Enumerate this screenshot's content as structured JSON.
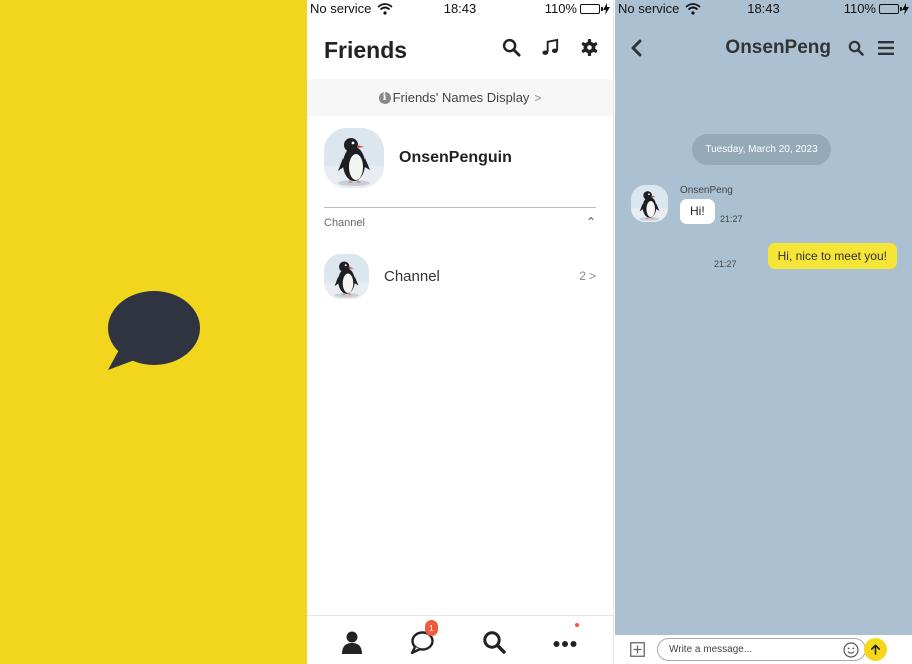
{
  "status_bar": {
    "carrier": "No service",
    "time": "18:43",
    "battery": "110%"
  },
  "splash": {
    "logo_icon": "speech-bubble-icon",
    "background": "#f2d61d"
  },
  "friends": {
    "title": "Friends",
    "header_icons": [
      "search-icon",
      "music-note-icon",
      "gear-icon"
    ],
    "names_display": "Friends' Names Display",
    "profile": {
      "name": "OnsenPenguin"
    },
    "section_label": "Channel",
    "channel": {
      "name": "Channel",
      "count": "2"
    },
    "tabs": [
      {
        "icon": "person-icon"
      },
      {
        "icon": "chat-bubble-icon",
        "badge": "1"
      },
      {
        "icon": "search-icon"
      },
      {
        "icon": "more-icon",
        "dot": true
      }
    ]
  },
  "chat": {
    "title": "OnsenPeng",
    "date": "Tuesday, March 20, 2023",
    "messages": [
      {
        "sender": "OnsenPeng",
        "text": "Hi!",
        "time": "21:27",
        "direction": "in"
      },
      {
        "text": "Hi, nice to meet you!",
        "time": "21:27",
        "direction": "out"
      }
    ],
    "composer_placeholder": "Write a message...",
    "background": "#abc1d1",
    "my_bubble_color": "#f5e536"
  }
}
